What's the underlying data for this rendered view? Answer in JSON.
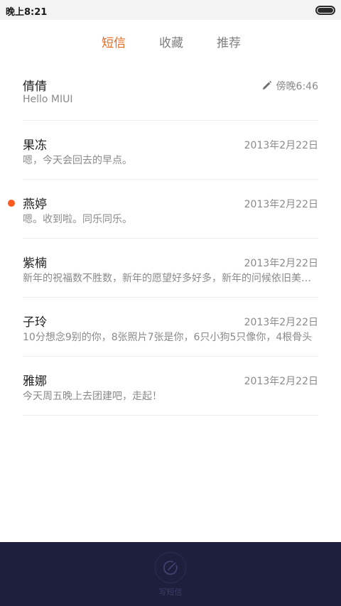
{
  "status_bar": {
    "time": "晚上8:21",
    "battery_level": 1.0
  },
  "tabs": [
    {
      "label": "短信",
      "active": true
    },
    {
      "label": "收藏",
      "active": false
    },
    {
      "label": "推荐",
      "active": false
    }
  ],
  "conversations": [
    {
      "name": "倩倩",
      "preview": "Hello MIUI",
      "time": "傍晚6:46",
      "draft": true,
      "unread": false
    },
    {
      "name": "果冻",
      "preview": "嗯，今天会回去的早点。",
      "time": "2013年2月22日",
      "draft": false,
      "unread": false
    },
    {
      "name": "燕婷",
      "preview": "嗯。收到啦。同乐同乐。",
      "time": "2013年2月22日",
      "draft": false,
      "unread": true
    },
    {
      "name": "紫楠",
      "preview": "新年的祝福数不胜数，新年的愿望好多好多，新年的问候依旧美好，",
      "time": "2013年2月22日",
      "draft": false,
      "unread": false
    },
    {
      "name": "子玲",
      "preview": "10分想念9别的你，8张照片7张是你，6只小狗5只像你，4根骨头",
      "time": "2013年2月22日",
      "draft": false,
      "unread": false
    },
    {
      "name": "雅娜",
      "preview": "今天周五晚上去团建吧，走起！",
      "time": "2013年2月22日",
      "draft": false,
      "unread": false
    }
  ],
  "bottom_bar": {
    "compose_label": "写短信",
    "compose_icon": "compose-icon"
  },
  "colors": {
    "accent": "#e8691e",
    "unread": "#ff5a1f",
    "bottom_bar": "#1d1f3d"
  }
}
